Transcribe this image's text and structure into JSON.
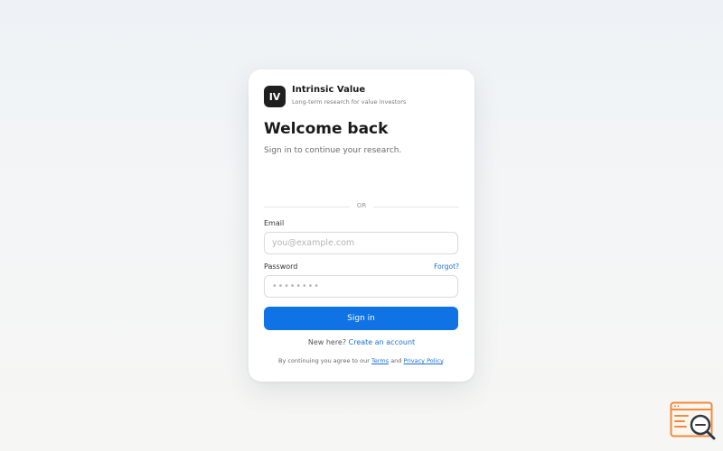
{
  "brand": {
    "logo_text": "IV",
    "name": "Intrinsic Value",
    "tagline": "Long-term research for value investors"
  },
  "header": {
    "title": "Welcome back",
    "subtitle": "Sign in to continue your research."
  },
  "divider": {
    "text": "OR"
  },
  "form": {
    "email_label": "Email",
    "email_placeholder": "you@example.com",
    "email_value": "",
    "password_label": "Password",
    "password_placeholder": "••••••••",
    "password_value": "",
    "forgot_label": "Forgot?",
    "submit_label": "Sign in"
  },
  "signup": {
    "prefix": "New here?",
    "link_label": "Create an account"
  },
  "legal": {
    "prefix": "By continuing you agree to our",
    "terms_label": "Terms",
    "and": "and",
    "privacy_label": "Privacy Policy",
    "suffix": "."
  },
  "colors": {
    "accent": "#0f73e6",
    "link": "#1a6fd1",
    "logo_tile": "#1f1f1f",
    "corner_badge": "#f08a3c"
  },
  "icons": {
    "corner": "magnifier-document-icon"
  }
}
